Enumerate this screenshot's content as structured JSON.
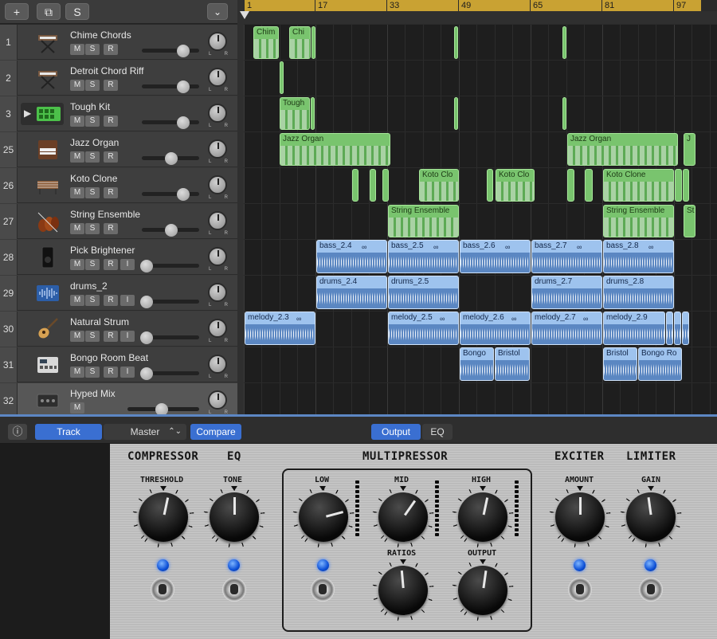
{
  "toolbar": {
    "add_label": "+",
    "dup_label": "⧉",
    "s_label": "S",
    "collapse_label": "⌄"
  },
  "ruler": {
    "marks": [
      "1",
      "17",
      "33",
      "49",
      "65",
      "81",
      "97"
    ]
  },
  "tracks": [
    {
      "num": "1",
      "name": "Chime Chords",
      "buttons": [
        "M",
        "S",
        "R"
      ],
      "icon": "keyboard-stand-icon"
    },
    {
      "num": "2",
      "name": "Detroit Chord Riff",
      "buttons": [
        "M",
        "S",
        "R"
      ],
      "icon": "keyboard-stand-icon"
    },
    {
      "num": "3",
      "name": "Tough Kit",
      "buttons": [
        "M",
        "S",
        "R"
      ],
      "icon": "drum-pad-icon"
    },
    {
      "num": "25",
      "name": "Jazz Organ",
      "buttons": [
        "M",
        "S",
        "R"
      ],
      "icon": "organ-icon"
    },
    {
      "num": "26",
      "name": "Koto Clone",
      "buttons": [
        "M",
        "S",
        "R"
      ],
      "icon": "koto-icon"
    },
    {
      "num": "27",
      "name": "String Ensemble",
      "buttons": [
        "M",
        "S",
        "R"
      ],
      "icon": "violin-icon"
    },
    {
      "num": "28",
      "name": "Pick Brightener",
      "buttons": [
        "M",
        "S",
        "R",
        "I"
      ],
      "icon": "amp-icon"
    },
    {
      "num": "29",
      "name": "drums_2",
      "buttons": [
        "M",
        "S",
        "R",
        "I"
      ],
      "icon": "waveform-icon"
    },
    {
      "num": "30",
      "name": "Natural Strum",
      "buttons": [
        "M",
        "S",
        "R",
        "I"
      ],
      "icon": "guitar-icon"
    },
    {
      "num": "31",
      "name": "Bongo Room Beat",
      "buttons": [
        "M",
        "S",
        "R",
        "I"
      ],
      "icon": "drum-machine-icon"
    },
    {
      "num": "32",
      "name": "Hyped Mix",
      "buttons": [
        "M"
      ],
      "icon": "mastering-icon"
    }
  ],
  "regions": {
    "chim": "Chim",
    "chi": "Chi",
    "tough": "Tough",
    "jazz1": "Jazz Organ",
    "jazz2": "Jazz Organ",
    "jazz3": "J",
    "koto1": "Koto Clo",
    "koto2": "Koto Clo",
    "koto3": "Koto Clone",
    "str1": "String Ensemble",
    "str2": "String Ensemble",
    "str3": "St",
    "bass4": "bass_2.4",
    "bass5": "bass_2.5",
    "bass6": "bass_2.6",
    "bass7": "bass_2.7",
    "bass8": "bass_2.8",
    "drums4": "drums_2.4",
    "drums5": "drums_2.5",
    "drums7": "drums_2.7",
    "drums8": "drums_2.8",
    "mel3": "melody_2.3",
    "mel5": "melody_2.5",
    "mel6": "melody_2.6",
    "mel7": "melody_2.7",
    "mel9": "melody_2.9",
    "bongo1": "Bongo",
    "bristol1": "Bristol",
    "bristol2": "Bristol",
    "bongo2": "Bongo Ro"
  },
  "plugin_bar": {
    "info": "ⓘ",
    "track": "Track",
    "master": "Master",
    "compare": "Compare",
    "output": "Output",
    "eq": "EQ"
  },
  "amp": {
    "sections": {
      "compressor": "COMPRESSOR",
      "eq": "EQ",
      "multipressor": "MULTIPRESSOR",
      "exciter": "EXCITER",
      "limiter": "LIMITER"
    },
    "knobs": {
      "threshold": "THRESHOLD",
      "tone": "TONE",
      "low": "LOW",
      "mid": "MID",
      "high": "HIGH",
      "ratios": "RATIOS",
      "output": "OUTPUT",
      "amount": "AMOUNT",
      "gain": "GAIN"
    }
  },
  "colors": {
    "green_region": "#79c46e",
    "blue_region": "#9ec3ee",
    "ruler": "#c9a233",
    "led_blue": "#0c4fd6",
    "selection": "#5d87c4"
  }
}
